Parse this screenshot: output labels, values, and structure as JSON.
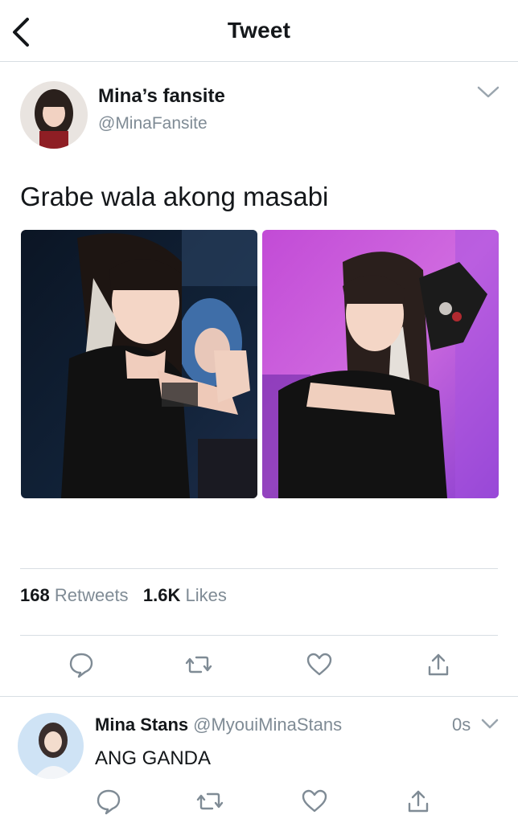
{
  "header": {
    "title": "Tweet"
  },
  "tweet": {
    "author_name": "Mina’s fansite",
    "author_handle": "@MinaFansite",
    "text": "Grabe wala akong masabi",
    "retweets_count": "168",
    "retweets_label": "Retweets",
    "likes_count": "1.6K",
    "likes_label": "Likes"
  },
  "reply": {
    "author_name": "Mina Stans",
    "author_handle": "@MyouiMinaStans",
    "time": "0s",
    "text": "ANG GANDA"
  },
  "icons": [
    "back-arrow-icon",
    "chevron-down-icon",
    "reply-icon",
    "retweet-icon",
    "like-icon",
    "share-icon"
  ],
  "colors": {
    "secondary_text": "#7f8b95",
    "icon": "#7f8b95",
    "divider": "#d8dee3"
  }
}
